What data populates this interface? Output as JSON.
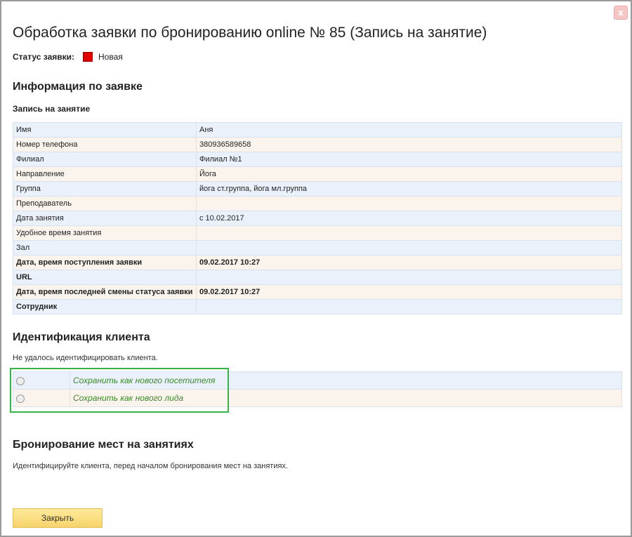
{
  "dialog": {
    "close_icon_label": "x",
    "title": "Обработка заявки по бронированию online № 85 (Запись на занятие)",
    "status": {
      "label": "Статус заявки:",
      "value": "Новая",
      "color": "#e00000"
    }
  },
  "info": {
    "heading": "Информация по заявке",
    "subheading": "Запись на занятие",
    "rows": [
      {
        "key": "Имя",
        "value": "Аня",
        "bold": false
      },
      {
        "key": "Номер телефона",
        "value": "380936589658",
        "bold": false
      },
      {
        "key": "Филиал",
        "value": "Филиал №1",
        "bold": false
      },
      {
        "key": "Направление",
        "value": "Йога",
        "bold": false
      },
      {
        "key": "Группа",
        "value": "йога ст.группа, йога мл.группа",
        "bold": false
      },
      {
        "key": "Преподаватель",
        "value": "",
        "bold": false
      },
      {
        "key": "Дата занятия",
        "value": "с 10.02.2017",
        "bold": false
      },
      {
        "key": "Удобное время занятия",
        "value": "",
        "bold": false
      },
      {
        "key": "Зал",
        "value": "",
        "bold": false
      },
      {
        "key": "Дата, время поступления заявки",
        "value": "09.02.2017 10:27",
        "bold": true
      },
      {
        "key": "URL",
        "value": "",
        "bold": true
      },
      {
        "key": "Дата, время последней смены статуса заявки",
        "value": "09.02.2017 10:27",
        "bold": true
      },
      {
        "key": "Сотрудник",
        "value": "",
        "bold": true
      }
    ]
  },
  "identification": {
    "heading": "Идентификация клиента",
    "note": "Не удалось идентифицировать клиента.",
    "options": [
      {
        "label": "Сохранить как нового посетителя"
      },
      {
        "label": "Сохранить как нового лида"
      }
    ]
  },
  "booking": {
    "heading": "Бронирование мест на занятиях",
    "note": "Идентифицируйте клиента, перед началом бронирования мест на занятиях."
  },
  "footer": {
    "close_label": "Закрыть"
  }
}
